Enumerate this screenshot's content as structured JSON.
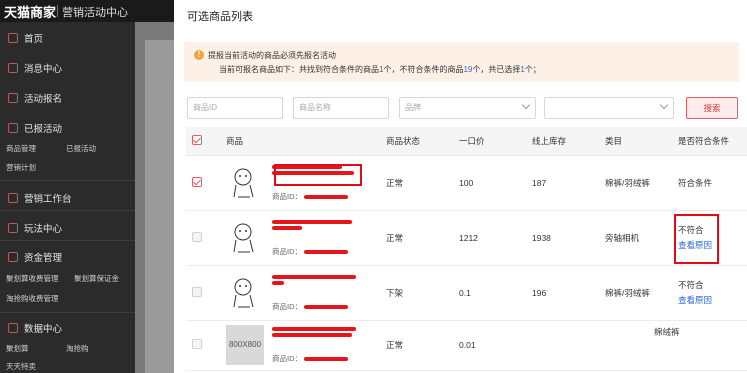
{
  "app": {
    "brand": "天猫商家",
    "section": "营销活动中心"
  },
  "sidebar": {
    "items": [
      {
        "label": "首页"
      },
      {
        "label": "消息中心"
      },
      {
        "label": "活动报名"
      },
      {
        "label": "已报活动"
      },
      {
        "label": "营销工作台"
      },
      {
        "label": "玩法中心"
      },
      {
        "label": "资金管理"
      },
      {
        "label": "数据中心"
      }
    ],
    "sub_reported": [
      "商品管理",
      "已报活动",
      "营销计划"
    ],
    "sub_funds": [
      "聚划算收费管理",
      "聚划算保证金",
      "淘抢购收费管理"
    ],
    "sub_data": [
      "聚划算",
      "淘抢购",
      "天天特卖"
    ]
  },
  "modal": {
    "title": "可选商品列表",
    "notice_line1": "提报当前活动的商品必须先报名活动",
    "notice_line2_a": "当前可报名商品如下：共找到符合条件的商品",
    "notice_count_ok": "1",
    "notice_line2_b": "个，不符合条件的商品",
    "notice_count_bad": "19",
    "notice_line2_c": "个，共已选择",
    "notice_count_sel": "1",
    "notice_line2_d": "个；"
  },
  "filters": {
    "product_id_placeholder": "商品ID",
    "product_name_placeholder": "商品名称",
    "brand_placeholder": "品牌",
    "search_label": "搜索"
  },
  "table": {
    "headers": [
      "商品",
      "商品状态",
      "一口价",
      "线上库存",
      "类目",
      "是否符合条件"
    ],
    "id_label": "商品ID：",
    "rows": [
      {
        "status": "正常",
        "price": "100",
        "stock": "187",
        "category": "棉裤/羽绒裤",
        "eligibility": "符合条件",
        "reason": "",
        "checked": true,
        "thumb": ""
      },
      {
        "status": "正常",
        "price": "1212",
        "stock": "1938",
        "category": "旁轴相机",
        "eligibility": "不符合",
        "reason": "查看原因",
        "checked": false,
        "thumb": ""
      },
      {
        "status": "下架",
        "price": "0.1",
        "stock": "196",
        "category": "棉裤/羽绒裤",
        "eligibility": "不符合",
        "reason": "查看原因",
        "checked": false,
        "thumb": ""
      },
      {
        "status": "正常",
        "price": "0.01",
        "stock": "",
        "category": "",
        "eligibility": "",
        "reason": "",
        "checked": false,
        "thumb": "800X800"
      }
    ],
    "overflow_category": "棉绒裤"
  },
  "colors": {
    "accent": "#e65c5c",
    "link": "#2b66d9",
    "redact": "#e8141b",
    "sidebar": "#2b2b2b"
  }
}
